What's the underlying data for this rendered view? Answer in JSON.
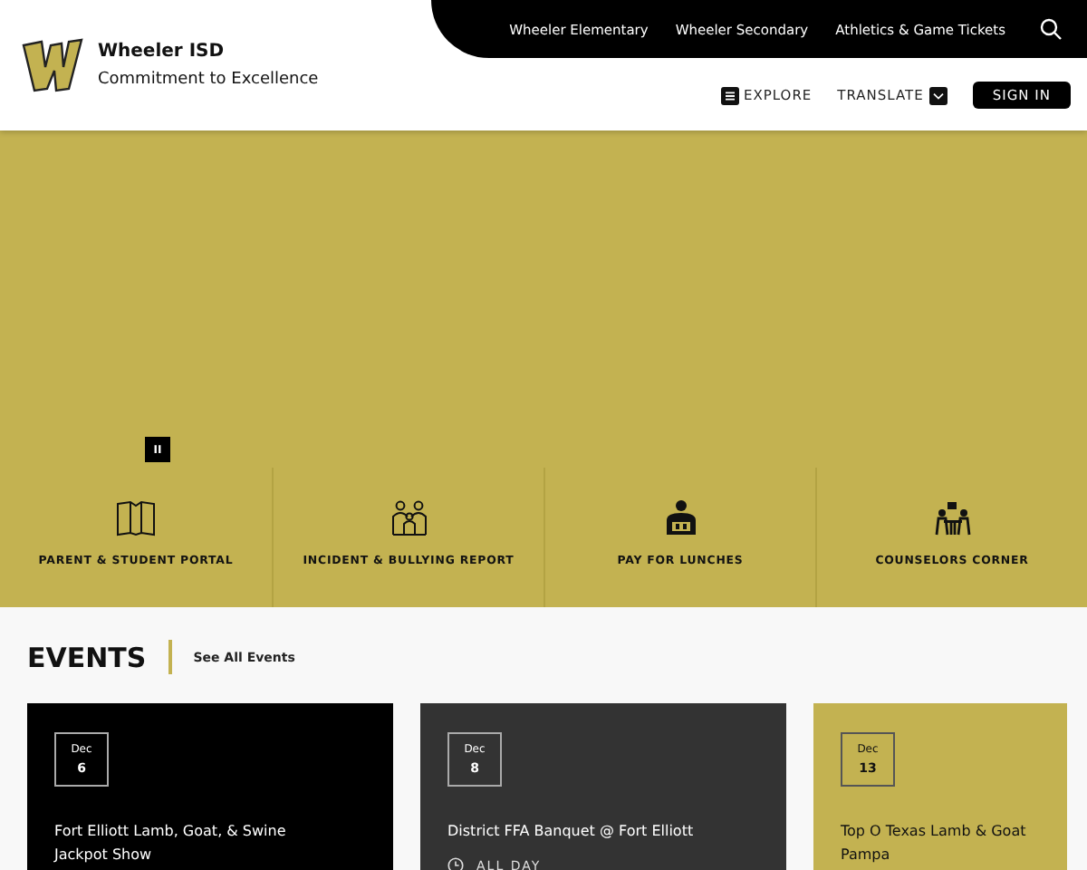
{
  "header": {
    "title": "Wheeler ISD",
    "tagline": "Commitment to Excellence"
  },
  "top_links": [
    "Wheeler Elementary",
    "Wheeler Secondary",
    "Athletics & Game Tickets"
  ],
  "utility": {
    "explore": "EXPLORE",
    "translate": "TRANSLATE",
    "sign_in": "SIGN IN"
  },
  "hero": {
    "pause": "II"
  },
  "quick_links": [
    {
      "label": "PARENT & STUDENT PORTAL"
    },
    {
      "label": "INCIDENT & BULLYING REPORT"
    },
    {
      "label": "PAY FOR LUNCHES"
    },
    {
      "label": "COUNSELORS CORNER"
    }
  ],
  "events": {
    "title": "EVENTS",
    "see_all": "See All Events",
    "items": [
      {
        "month": "Dec",
        "day": "6",
        "title": "Fort Elliott Lamb, Goat, & Swine Jackpot Show"
      },
      {
        "month": "Dec",
        "day": "8",
        "title": "District FFA Banquet @ Fort Elliott",
        "time": "ALL DAY"
      },
      {
        "month": "Dec",
        "day": "13",
        "title": "Top O Texas Lamb & Goat Pampa"
      }
    ]
  }
}
